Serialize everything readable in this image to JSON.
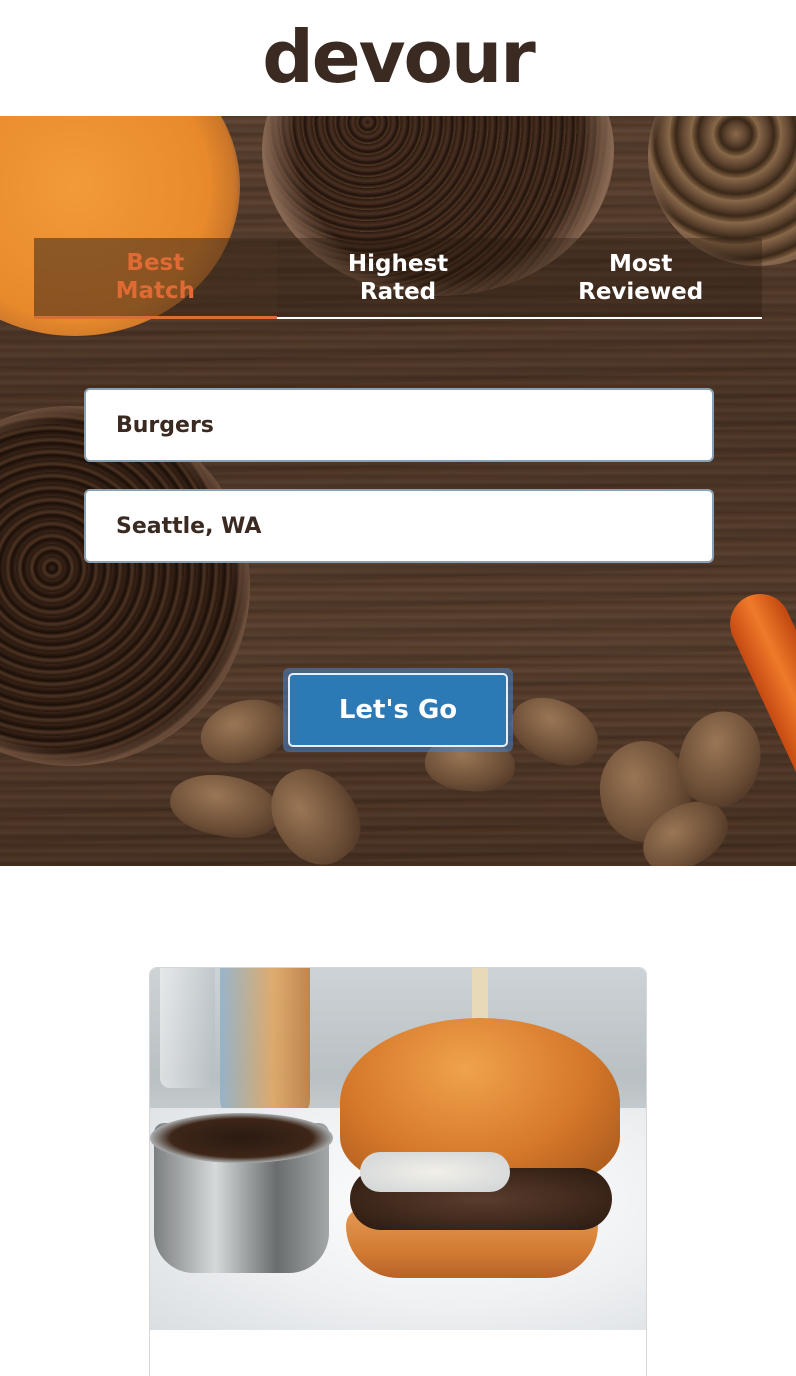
{
  "app": {
    "logo": "devour"
  },
  "sort_tabs": [
    {
      "label": "Best\nMatch",
      "active": true
    },
    {
      "label": "Highest\nRated",
      "active": false
    },
    {
      "label": "Most\nReviewed",
      "active": false
    }
  ],
  "search": {
    "term_value": "Burgers",
    "location_value": "Seattle, WA",
    "submit_label": "Let's Go"
  },
  "results": [
    {
      "title": ""
    }
  ],
  "colors": {
    "accent": "#e06a33",
    "button": "#2b7ab6",
    "logo": "#3b2a21"
  }
}
